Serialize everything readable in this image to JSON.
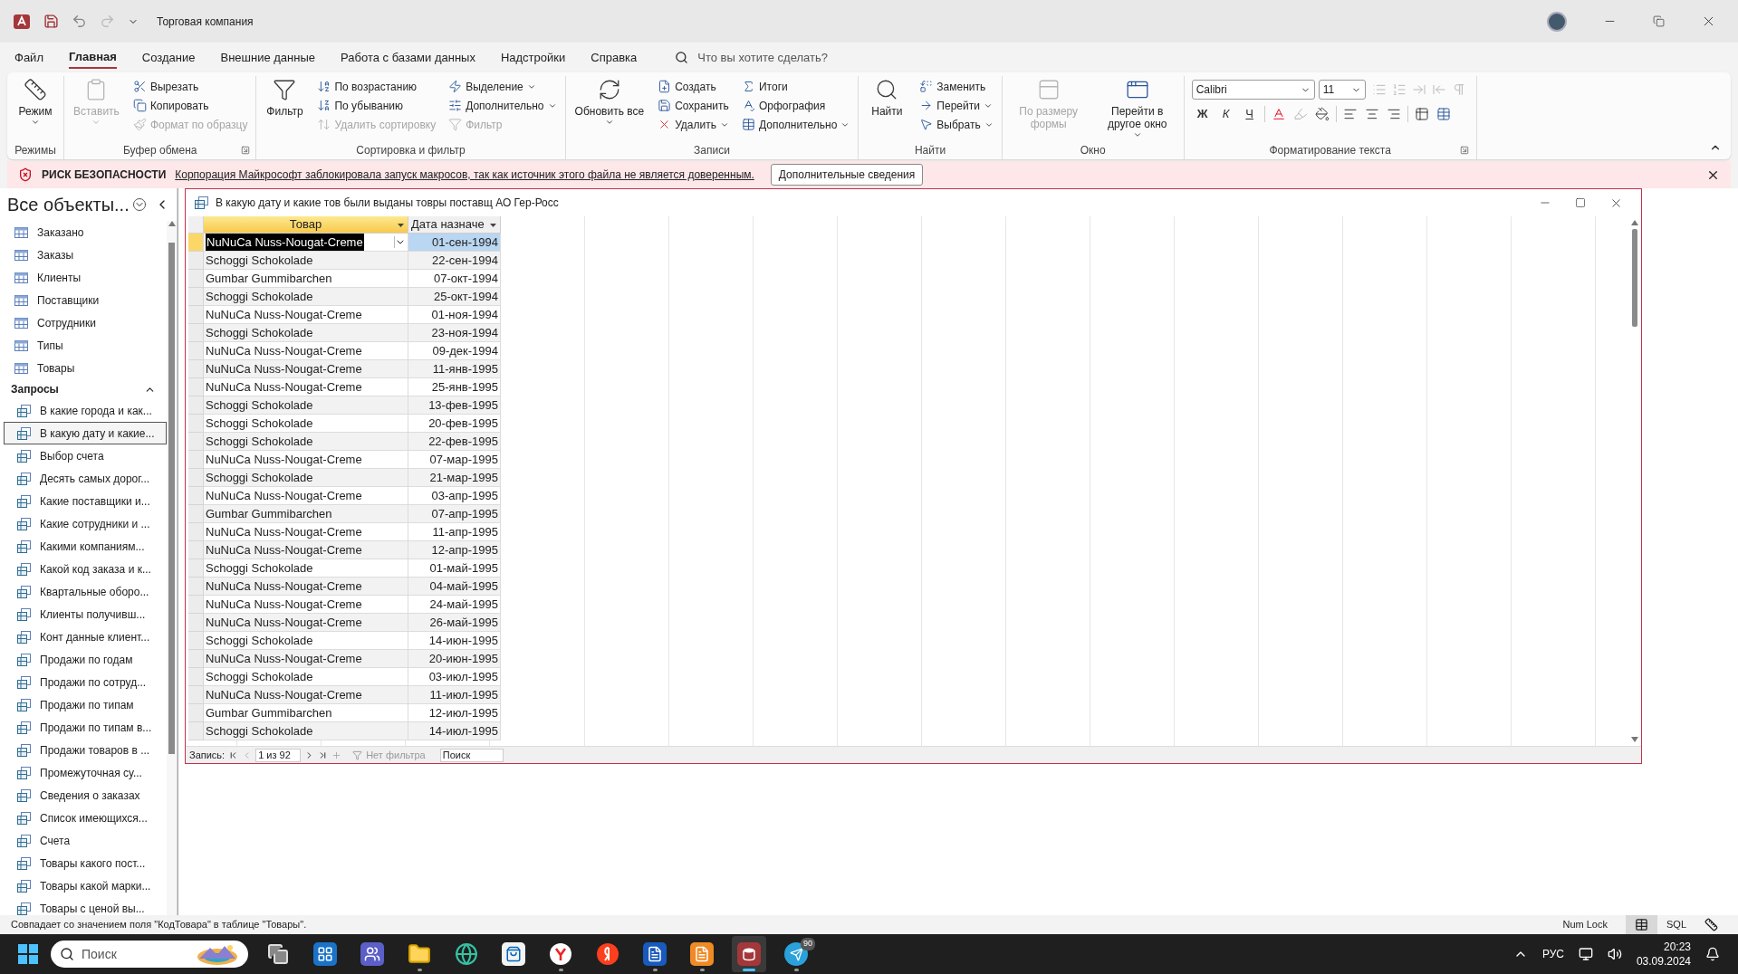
{
  "window": {
    "title": "Торговая компания"
  },
  "menu_tabs": [
    {
      "label": "Файл",
      "selected": false
    },
    {
      "label": "Главная",
      "selected": true
    },
    {
      "label": "Создание",
      "selected": false
    },
    {
      "label": "Внешние данные",
      "selected": false
    },
    {
      "label": "Работа с базами данных",
      "selected": false
    },
    {
      "label": "Надстройки",
      "selected": false
    },
    {
      "label": "Справка",
      "selected": false
    }
  ],
  "tell_me": {
    "placeholder": "Что вы хотите сделать?"
  },
  "ribbon_groups": [
    {
      "label": "Режимы",
      "launcher": false,
      "items": [
        {
          "kind": "large",
          "label": "Режим",
          "disabled": false,
          "dropdown": true
        }
      ]
    },
    {
      "label": "Буфер обмена",
      "launcher": true,
      "items": [
        {
          "kind": "large",
          "label": "Вставить",
          "disabled": true,
          "dropdown": true
        },
        {
          "kind": "small",
          "label": "Вырезать",
          "disabled": false,
          "dropdown": false
        },
        {
          "kind": "small",
          "label": "Копировать",
          "disabled": false,
          "dropdown": false
        },
        {
          "kind": "small",
          "label": "Формат по образцу",
          "disabled": true,
          "dropdown": false
        }
      ]
    },
    {
      "label": "Сортировка и фильтр",
      "launcher": false,
      "items": [
        {
          "kind": "large",
          "label": "Фильтр",
          "disabled": false,
          "dropdown": false
        },
        {
          "kind": "small",
          "label": "По возрастанию",
          "disabled": false,
          "dropdown": false
        },
        {
          "kind": "small",
          "label": "По убыванию",
          "disabled": false,
          "dropdown": false
        },
        {
          "kind": "small",
          "label": "Удалить сортировку",
          "disabled": true,
          "dropdown": false
        },
        {
          "kind": "small",
          "label": "Выделение",
          "disabled": false,
          "dropdown": true
        },
        {
          "kind": "small",
          "label": "Дополнительно",
          "disabled": false,
          "dropdown": true
        },
        {
          "kind": "small",
          "label": "Фильтр",
          "disabled": true,
          "dropdown": false
        }
      ]
    },
    {
      "label": "Записи",
      "launcher": false,
      "items": [
        {
          "kind": "large",
          "label": "Обновить все",
          "disabled": false,
          "dropdown": true
        },
        {
          "kind": "small",
          "label": "Создать",
          "disabled": false,
          "dropdown": false
        },
        {
          "kind": "small",
          "label": "Сохранить",
          "disabled": false,
          "dropdown": false
        },
        {
          "kind": "small",
          "label": "Удалить",
          "disabled": false,
          "dropdown": true
        },
        {
          "kind": "small",
          "label": "Итоги",
          "disabled": false,
          "dropdown": false
        },
        {
          "kind": "small",
          "label": "Орфография",
          "disabled": false,
          "dropdown": false
        },
        {
          "kind": "small",
          "label": "Дополнительно",
          "disabled": false,
          "dropdown": true
        }
      ]
    },
    {
      "label": "Найти",
      "launcher": false,
      "items": [
        {
          "kind": "large",
          "label": "Найти",
          "disabled": false,
          "dropdown": false
        },
        {
          "kind": "small",
          "label": "Заменить",
          "disabled": false,
          "dropdown": false
        },
        {
          "kind": "small",
          "label": "Перейти",
          "disabled": false,
          "dropdown": true
        },
        {
          "kind": "small",
          "label": "Выбрать",
          "disabled": false,
          "dropdown": true
        }
      ]
    },
    {
      "label": "Окно",
      "launcher": false,
      "items": [
        {
          "kind": "large",
          "label": "По размеру формы",
          "disabled": true,
          "dropdown": false
        },
        {
          "kind": "large",
          "label": "Перейти в другое окно",
          "disabled": false,
          "dropdown": true
        }
      ]
    }
  ],
  "text_formatting": {
    "label": "Форматирование текста",
    "font": {
      "value": "Calibri"
    },
    "size": {
      "value": "11"
    },
    "paragraph_disabled": true,
    "style_buttons": [
      {
        "kind": "bold",
        "label": "Ж"
      },
      {
        "kind": "italic",
        "label": "К"
      },
      {
        "kind": "underline",
        "label": "Ч"
      }
    ]
  },
  "security_bar": {
    "title": "РИСК БЕЗОПАСНОСТИ",
    "message": "Корпорация Майкрософт заблокировала запуск макросов, так как источник этого файла не является доверенным.",
    "button": "Дополнительные сведения"
  },
  "nav_pane": {
    "title": "Все объекты...",
    "tables": [
      {
        "label": "Заказано"
      },
      {
        "label": "Заказы"
      },
      {
        "label": "Клиенты"
      },
      {
        "label": "Поставщики"
      },
      {
        "label": "Сотрудники"
      },
      {
        "label": "Типы"
      },
      {
        "label": "Товары"
      }
    ],
    "queries_header": {
      "label": "Запросы",
      "expanded": true
    },
    "queries": [
      {
        "label": "В какие города и как...",
        "selected": false
      },
      {
        "label": "В какую дату и какие...",
        "selected": true
      },
      {
        "label": "Выбор счета",
        "selected": false
      },
      {
        "label": "Десять самых дорог...",
        "selected": false
      },
      {
        "label": "Какие поставщики и...",
        "selected": false
      },
      {
        "label": "Какие сотрудники и ...",
        "selected": false
      },
      {
        "label": "Какими компаниям...",
        "selected": false
      },
      {
        "label": "Какой код заказа и к...",
        "selected": false
      },
      {
        "label": "Квартальные оборо...",
        "selected": false
      },
      {
        "label": "Клиенты получивш...",
        "selected": false
      },
      {
        "label": "Конт данные клиент...",
        "selected": false
      },
      {
        "label": "Продажи по годам",
        "selected": false
      },
      {
        "label": "Продажи по сотруд...",
        "selected": false
      },
      {
        "label": "Продажи по типам",
        "selected": false
      },
      {
        "label": "Продажи по типам в...",
        "selected": false
      },
      {
        "label": "Продажи товаров в ...",
        "selected": false
      },
      {
        "label": "Промежуточная су...",
        "selected": false
      },
      {
        "label": "Сведения о заказах",
        "selected": false
      },
      {
        "label": "Список имеющихся...",
        "selected": false
      },
      {
        "label": "Счета",
        "selected": false
      },
      {
        "label": "Товары какого пост...",
        "selected": false
      },
      {
        "label": "Товары какой марки...",
        "selected": false
      },
      {
        "label": "Товары с ценой вы...",
        "selected": false
      }
    ]
  },
  "document": {
    "title": "В какую дату и какие тов были выданы товры поставщ АО Гер-Росс",
    "columns": [
      {
        "label": "Товар",
        "selected": true
      },
      {
        "label": "Дата назначе",
        "selected": false
      }
    ],
    "rows": [
      {
        "cells": [
          "NuNuCa Nuss-Nougat-Creme",
          "01-сен-1994"
        ],
        "selected": true
      },
      {
        "cells": [
          "Schoggi Schokolade",
          "22-сен-1994"
        ],
        "selected": false
      },
      {
        "cells": [
          "Gumbar Gummibarchen",
          "07-окт-1994"
        ],
        "selected": false
      },
      {
        "cells": [
          "Schoggi Schokolade",
          "25-окт-1994"
        ],
        "selected": false
      },
      {
        "cells": [
          "NuNuCa Nuss-Nougat-Creme",
          "01-ноя-1994"
        ],
        "selected": false
      },
      {
        "cells": [
          "Schoggi Schokolade",
          "23-ноя-1994"
        ],
        "selected": false
      },
      {
        "cells": [
          "NuNuCa Nuss-Nougat-Creme",
          "09-дек-1994"
        ],
        "selected": false
      },
      {
        "cells": [
          "NuNuCa Nuss-Nougat-Creme",
          "11-янв-1995"
        ],
        "selected": false
      },
      {
        "cells": [
          "NuNuCa Nuss-Nougat-Creme",
          "25-янв-1995"
        ],
        "selected": false
      },
      {
        "cells": [
          "Schoggi Schokolade",
          "13-фев-1995"
        ],
        "selected": false
      },
      {
        "cells": [
          "Schoggi Schokolade",
          "20-фев-1995"
        ],
        "selected": false
      },
      {
        "cells": [
          "Schoggi Schokolade",
          "22-фев-1995"
        ],
        "selected": false
      },
      {
        "cells": [
          "NuNuCa Nuss-Nougat-Creme",
          "07-мар-1995"
        ],
        "selected": false
      },
      {
        "cells": [
          "Schoggi Schokolade",
          "21-мар-1995"
        ],
        "selected": false
      },
      {
        "cells": [
          "NuNuCa Nuss-Nougat-Creme",
          "03-апр-1995"
        ],
        "selected": false
      },
      {
        "cells": [
          "Gumbar Gummibarchen",
          "07-апр-1995"
        ],
        "selected": false
      },
      {
        "cells": [
          "NuNuCa Nuss-Nougat-Creme",
          "11-апр-1995"
        ],
        "selected": false
      },
      {
        "cells": [
          "NuNuCa Nuss-Nougat-Creme",
          "12-апр-1995"
        ],
        "selected": false
      },
      {
        "cells": [
          "Schoggi Schokolade",
          "01-май-1995"
        ],
        "selected": false
      },
      {
        "cells": [
          "NuNuCa Nuss-Nougat-Creme",
          "04-май-1995"
        ],
        "selected": false
      },
      {
        "cells": [
          "NuNuCa Nuss-Nougat-Creme",
          "24-май-1995"
        ],
        "selected": false
      },
      {
        "cells": [
          "NuNuCa Nuss-Nougat-Creme",
          "26-май-1995"
        ],
        "selected": false
      },
      {
        "cells": [
          "Schoggi Schokolade",
          "14-июн-1995"
        ],
        "selected": false
      },
      {
        "cells": [
          "NuNuCa Nuss-Nougat-Creme",
          "20-июн-1995"
        ],
        "selected": false
      },
      {
        "cells": [
          "Schoggi Schokolade",
          "03-июл-1995"
        ],
        "selected": false
      },
      {
        "cells": [
          "NuNuCa Nuss-Nougat-Creme",
          "11-июл-1995"
        ],
        "selected": false
      },
      {
        "cells": [
          "Gumbar Gummibarchen",
          "12-июл-1995"
        ],
        "selected": false
      },
      {
        "cells": [
          "Schoggi Schokolade",
          "14-июл-1995"
        ],
        "selected": false
      }
    ],
    "record_nav": {
      "label": "Запись:",
      "position": "1 из 92",
      "filter": "Нет фильтра",
      "search": {
        "placeholder": "Поиск"
      }
    }
  },
  "status_bar": {
    "message": "Совпадает со значением поля \"КодТовара\" в таблице \"Товары\".",
    "num_lock": "Num Lock",
    "views": [
      {
        "kind": "datasheet",
        "selected": true
      },
      {
        "kind": "sql",
        "label": "SQL",
        "selected": false
      },
      {
        "kind": "design",
        "selected": false
      }
    ]
  },
  "taskbar": {
    "search": {
      "placeholder": "Поиск"
    },
    "apps": [
      {
        "kind": "taskview",
        "running": false,
        "selected": false
      },
      {
        "kind": "widgets",
        "running": false,
        "selected": false
      },
      {
        "kind": "teams",
        "running": false,
        "selected": false
      },
      {
        "kind": "folder",
        "running": true,
        "selected": false
      },
      {
        "kind": "browser",
        "running": false,
        "selected": false
      },
      {
        "kind": "store",
        "running": false,
        "selected": false
      },
      {
        "kind": "ybrowser",
        "running": true,
        "selected": false
      },
      {
        "kind": "yandex",
        "running": false,
        "selected": false
      },
      {
        "kind": "word",
        "running": true,
        "selected": false
      },
      {
        "kind": "pdf",
        "running": true,
        "selected": false
      },
      {
        "kind": "access",
        "running": true,
        "selected": true
      },
      {
        "kind": "messenger",
        "running": true,
        "selected": false,
        "badge": "90"
      }
    ],
    "language": "РУС",
    "time": "20:23",
    "date": "03.09.2024"
  }
}
